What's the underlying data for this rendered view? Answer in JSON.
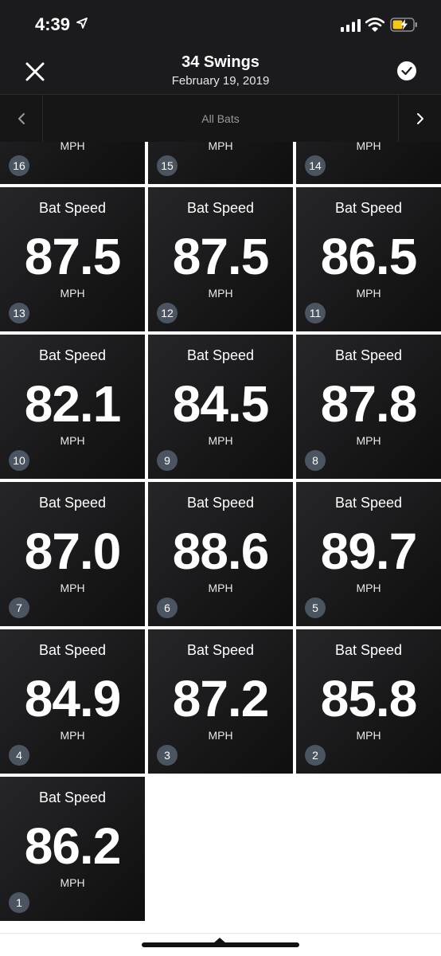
{
  "status": {
    "time": "4:39"
  },
  "header": {
    "title": "34 Swings",
    "subtitle": "February 19, 2019"
  },
  "filter": {
    "label": "All Bats"
  },
  "partial_tiles": [
    {
      "unit": "MPH",
      "number": "16"
    },
    {
      "unit": "MPH",
      "number": "15"
    },
    {
      "unit": "MPH",
      "number": "14"
    }
  ],
  "tiles": [
    {
      "title": "Bat Speed",
      "value": "87.5",
      "unit": "MPH",
      "number": "13"
    },
    {
      "title": "Bat Speed",
      "value": "87.5",
      "unit": "MPH",
      "number": "12"
    },
    {
      "title": "Bat Speed",
      "value": "86.5",
      "unit": "MPH",
      "number": "11"
    },
    {
      "title": "Bat Speed",
      "value": "82.1",
      "unit": "MPH",
      "number": "10"
    },
    {
      "title": "Bat Speed",
      "value": "84.5",
      "unit": "MPH",
      "number": "9"
    },
    {
      "title": "Bat Speed",
      "value": "87.8",
      "unit": "MPH",
      "number": "8"
    },
    {
      "title": "Bat Speed",
      "value": "87.0",
      "unit": "MPH",
      "number": "7"
    },
    {
      "title": "Bat Speed",
      "value": "88.6",
      "unit": "MPH",
      "number": "6"
    },
    {
      "title": "Bat Speed",
      "value": "89.7",
      "unit": "MPH",
      "number": "5"
    },
    {
      "title": "Bat Speed",
      "value": "84.9",
      "unit": "MPH",
      "number": "4"
    },
    {
      "title": "Bat Speed",
      "value": "87.2",
      "unit": "MPH",
      "number": "3"
    },
    {
      "title": "Bat Speed",
      "value": "85.8",
      "unit": "MPH",
      "number": "2"
    },
    {
      "title": "Bat Speed",
      "value": "86.2",
      "unit": "MPH",
      "number": "1"
    }
  ],
  "icons": {
    "location": "location-arrow-icon",
    "signal": "cellular-signal-icon",
    "wifi": "wifi-icon",
    "battery": "battery-charging-icon",
    "close": "close-icon",
    "check": "checkmark-icon",
    "prev": "chevron-left-icon",
    "next": "chevron-right-icon"
  },
  "colors": {
    "background": "#1b1b1d",
    "tile": "#1d1d1f",
    "badge": "#4b5561",
    "battery_charge": "#f5c518",
    "text": "#ffffff"
  }
}
